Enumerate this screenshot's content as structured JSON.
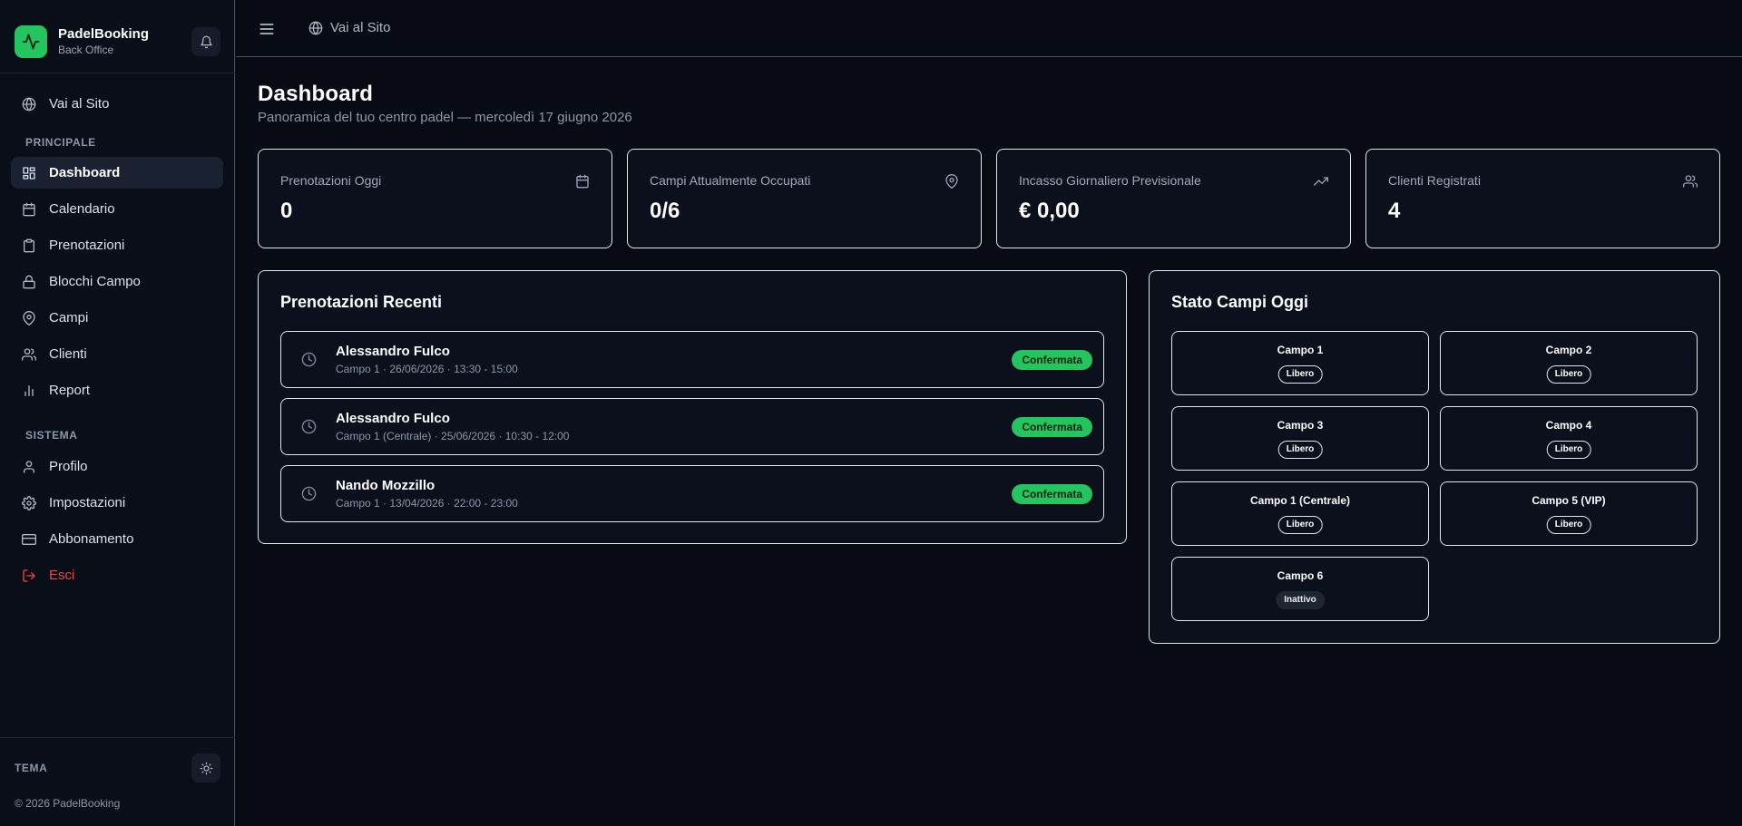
{
  "brand": {
    "name": "PadelBooking",
    "subtitle": "Back Office",
    "accent_color": "#22c55e",
    "logo_icon": "activity-icon"
  },
  "sidebar": {
    "top_link": {
      "label": "Vai al Sito",
      "icon": "globe-icon"
    },
    "section_main": "PRINCIPALE",
    "main_items": [
      {
        "label": "Dashboard",
        "icon": "grid-icon",
        "active": true
      },
      {
        "label": "Calendario",
        "icon": "calendar-icon"
      },
      {
        "label": "Prenotazioni",
        "icon": "clipboard-icon"
      },
      {
        "label": "Blocchi Campo",
        "icon": "lock-icon"
      },
      {
        "label": "Campi",
        "icon": "map-pin-icon"
      },
      {
        "label": "Clienti",
        "icon": "users-icon"
      },
      {
        "label": "Report",
        "icon": "bar-chart-icon"
      }
    ],
    "section_system": "SISTEMA",
    "system_items": [
      {
        "label": "Profilo",
        "icon": "user-icon"
      },
      {
        "label": "Impostazioni",
        "icon": "gear-icon"
      },
      {
        "label": "Abbonamento",
        "icon": "credit-card-icon"
      },
      {
        "label": "Esci",
        "icon": "logout-icon",
        "danger_color": "#ef4444"
      }
    ],
    "theme_label": "TEMA",
    "copyright": "© 2026 PadelBooking"
  },
  "topbar": {
    "link_label": "Vai al Sito"
  },
  "page": {
    "title": "Dashboard",
    "subtitle": "Panoramica del tuo centro padel — mercoledì 17 giugno 2026"
  },
  "stats": [
    {
      "label": "Prenotazioni Oggi",
      "value": "0",
      "icon": "calendar-icon"
    },
    {
      "label": "Campi Attualmente Occupati",
      "value": "0/6",
      "icon": "map-pin-icon"
    },
    {
      "label": "Incasso Giornaliero Previsionale",
      "value": "€ 0,00",
      "icon": "trending-up-icon"
    },
    {
      "label": "Clienti Registrati",
      "value": "4",
      "icon": "users-icon"
    }
  ],
  "recent_bookings": {
    "title": "Prenotazioni Recenti",
    "items": [
      {
        "name": "Alessandro Fulco",
        "meta": "Campo 1 · 26/06/2026 · 13:30 - 15:00",
        "status": "Confermata"
      },
      {
        "name": "Alessandro Fulco",
        "meta": "Campo 1 (Centrale) · 25/06/2026 · 10:30 - 12:00",
        "status": "Confermata"
      },
      {
        "name": "Nando Mozzillo",
        "meta": "Campo 1 · 13/04/2026 · 22:00 - 23:00",
        "status": "Confermata"
      }
    ]
  },
  "courts_status": {
    "title": "Stato Campi Oggi",
    "items": [
      {
        "name": "Campo 1",
        "status": "Libero"
      },
      {
        "name": "Campo 2",
        "status": "Libero"
      },
      {
        "name": "Campo 3",
        "status": "Libero"
      },
      {
        "name": "Campo 4",
        "status": "Libero"
      },
      {
        "name": "Campo 1 (Centrale)",
        "status": "Libero"
      },
      {
        "name": "Campo 5 (VIP)",
        "status": "Libero"
      },
      {
        "name": "Campo 6",
        "status": "Inattivo"
      }
    ]
  }
}
